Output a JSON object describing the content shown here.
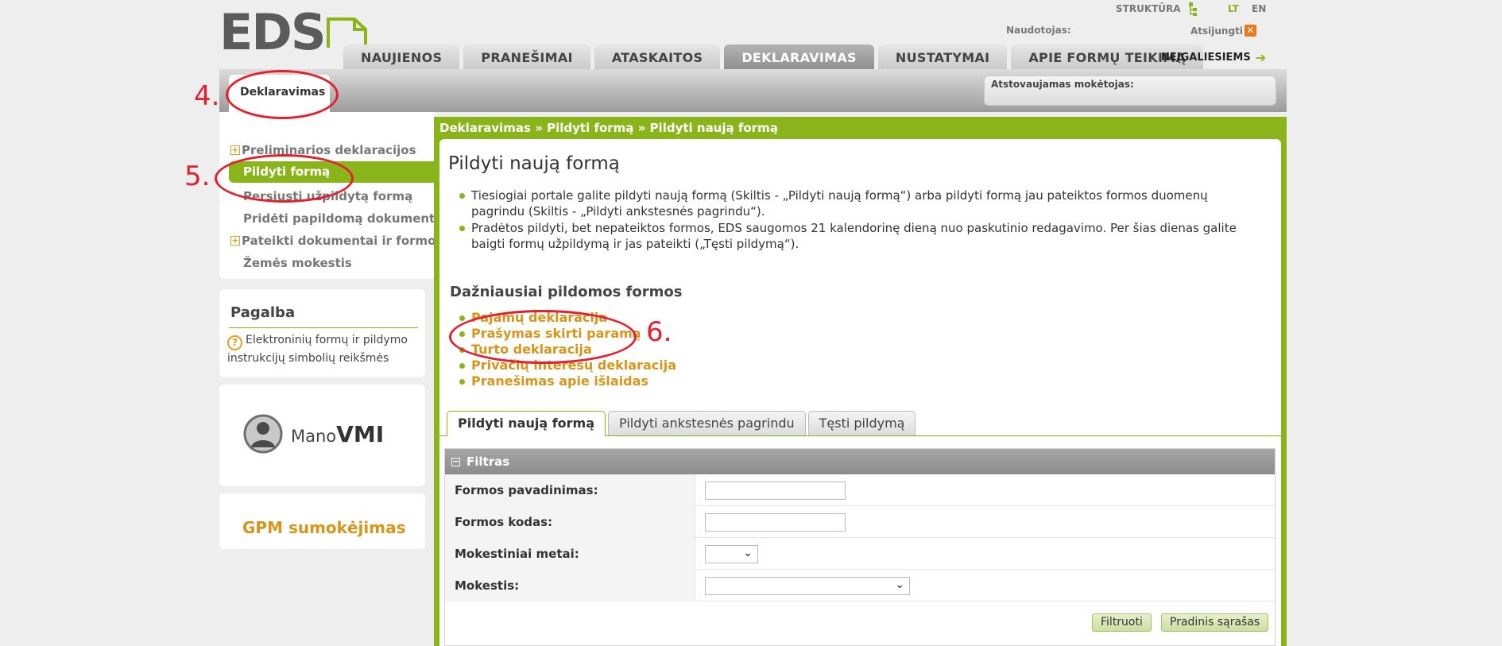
{
  "header": {
    "logo_text": "EDS",
    "structure_link": "STRUKTŪRA",
    "languages": [
      "LT",
      "EN"
    ],
    "user_label": "Naudotojas:",
    "logout_label": "Atsijungti",
    "accessibility_label": "NEĮGALIESIEMS"
  },
  "nav": {
    "tabs": [
      {
        "label": "NAUJIENOS",
        "active": false
      },
      {
        "label": "PRANEŠIMAI",
        "active": false
      },
      {
        "label": "ATASKAITOS",
        "active": false
      },
      {
        "label": "DEKLARAVIMAS",
        "active": true
      },
      {
        "label": "NUSTATYMAI",
        "active": false
      },
      {
        "label": "APIE FORMŲ TEIKIMĄ",
        "active": false
      }
    ]
  },
  "section": {
    "tab_label": "Deklaravimas",
    "payer_label": "Atstovaujamas mokėtojas:"
  },
  "sidebar": {
    "items": [
      {
        "label": "Preliminarios deklaracijos",
        "expandable": true,
        "active": false
      },
      {
        "label": "Pildyti formą",
        "expandable": false,
        "active": true
      },
      {
        "label": "Persiųsti užpildytą formą",
        "expandable": false,
        "active": false
      },
      {
        "label": "Pridėti papildomą dokumentą",
        "expandable": false,
        "active": false
      },
      {
        "label": "Pateikti dokumentai ir formos",
        "expandable": true,
        "active": false
      },
      {
        "label": "Žemės mokestis",
        "expandable": false,
        "active": false
      }
    ],
    "help_title": "Pagalba",
    "help_text": "Elektroninių formų ir pildymo instrukcijų simbolių reikšmės",
    "mano_prefix": "Mano",
    "mano_bold": "VMI",
    "gpm_label": "GPM sumokėjimas"
  },
  "main": {
    "breadcrumb": "Deklaravimas » Pildyti formą » Pildyti naują formą",
    "title": "Pildyti naują formą",
    "bullets": [
      "Tiesiogiai portale galite pildyti naują formą (Skiltis - „Pildyti naują formą“) arba pildyti formą jau pateiktos formos duomenų pagrindu (Skiltis - „Pildyti ankstesnės pagrindu“).",
      "Pradėtos pildyti, bet nepateiktos formos, EDS saugomos 21 kalendorinę dieną nuo paskutinio redagavimo. Per šias dienas galite baigti formų užpildymą ir jas pateikti („Tęsti pildymą“)."
    ],
    "frequent_title": "Dažniausiai pildomos formos",
    "frequent_forms": [
      "Pajamų deklaracija",
      "Prašymas skirti paramą",
      "Turto deklaracija",
      "Privačių interesų deklaracija",
      "Pranešimas apie išlaidas"
    ],
    "subtabs": [
      {
        "label": "Pildyti naują formą",
        "active": true
      },
      {
        "label": "Pildyti ankstesnės pagrindu",
        "active": false
      },
      {
        "label": "Tęsti pildymą",
        "active": false
      }
    ],
    "filter": {
      "title": "Filtras",
      "fields": [
        {
          "label": "Formos pavadinimas:",
          "type": "text",
          "value": ""
        },
        {
          "label": "Formos kodas:",
          "type": "text",
          "value": ""
        },
        {
          "label": "Mokestiniai metai:",
          "type": "select",
          "value": ""
        },
        {
          "label": "Mokestis:",
          "type": "select",
          "value": ""
        }
      ],
      "filter_button": "Filtruoti",
      "reset_button": "Pradinis sąrašas"
    }
  },
  "annotations": {
    "labels": [
      "4.",
      "5.",
      "6."
    ],
    "color": "#e4202e"
  },
  "colors": {
    "accent_green": "#8ab51a",
    "link_orange": "#d9951a"
  }
}
